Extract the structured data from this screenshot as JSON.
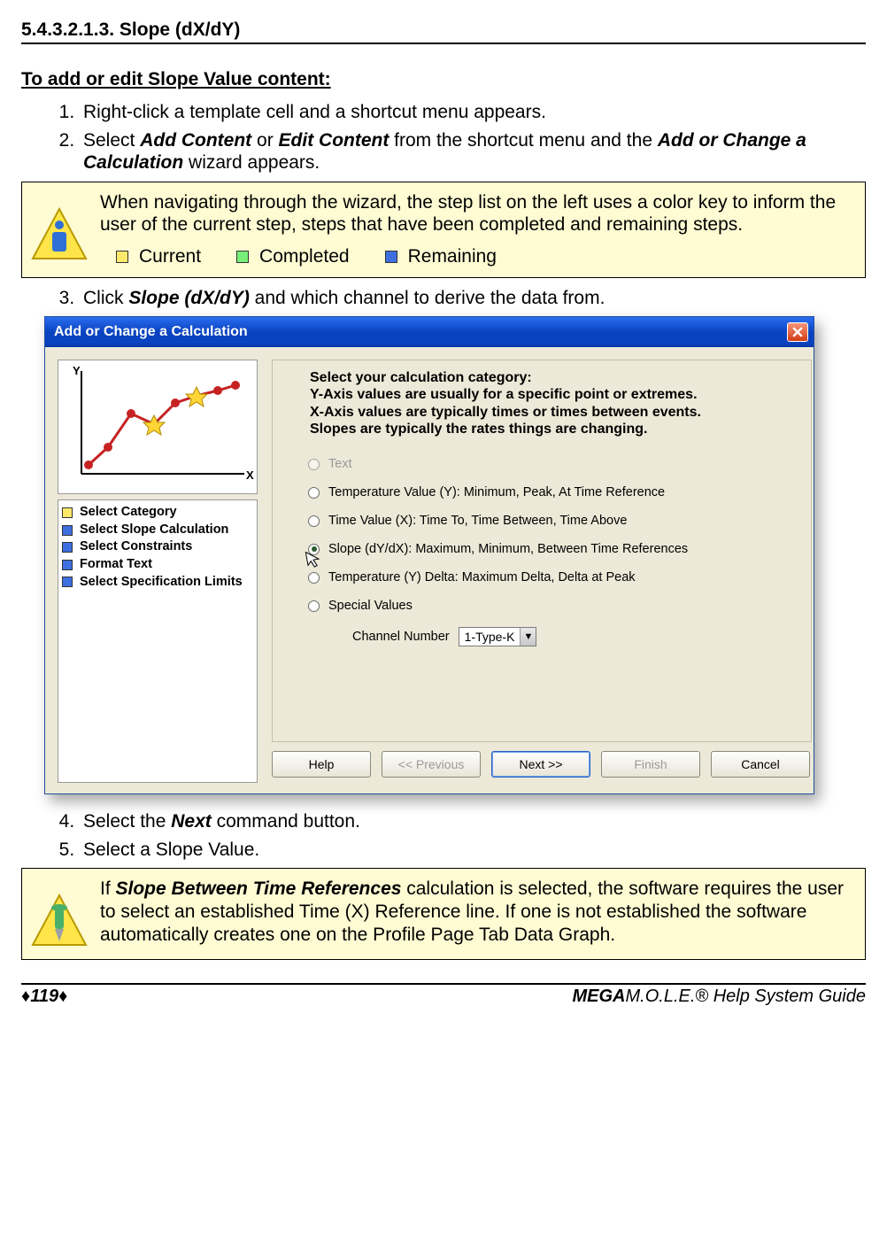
{
  "section_number": "5.4.3.2.1.3. Slope (dX/dY)",
  "sub_heading": "To add or edit Slope Value content:",
  "steps": {
    "s1": "Right-click a template cell and a shortcut menu appears.",
    "s2a": "Select ",
    "s2b": "Add Content",
    "s2c": " or ",
    "s2d": "Edit Content",
    "s2e": " from the shortcut menu and the ",
    "s2f": "Add or Change a Calculation",
    "s2g": " wizard appears.",
    "s3a": "Click ",
    "s3b": "Slope (dX/dY)",
    "s3c": " and which channel to derive the data from.",
    "s4a": "Select the ",
    "s4b": "Next",
    "s4c": " command button.",
    "s5": "Select a Slope Value."
  },
  "note1": {
    "text": "When navigating through the wizard, the step list on the left uses a color key to inform the user of the current step, steps that have been completed and remaining steps.",
    "legend": {
      "current": "Current",
      "completed": "Completed",
      "remaining": "Remaining"
    }
  },
  "note2": {
    "a": "If ",
    "b": "Slope Between Time References",
    "c": " calculation is selected, the software requires the user to select an established Time (X) Reference line. If one is not established the software automatically creates one on the Profile Page Tab Data Graph."
  },
  "dialog": {
    "title": "Add or Change a Calculation",
    "steps": [
      "Select Category",
      "Select Slope Calculation",
      "Select Constraints",
      "Format Text",
      "Select Specification Limits"
    ],
    "group_head": {
      "l1": "Select your calculation category:",
      "l2": "Y-Axis values are usually for a specific point or extremes.",
      "l3": "X-Axis values are typically times or times between events.",
      "l4": "Slopes are typically the rates things are changing."
    },
    "radios": {
      "r0": "Text",
      "r1": "Temperature Value (Y):  Minimum, Peak, At Time Reference",
      "r2": "Time Value (X):  Time To, Time Between, Time Above",
      "r3": "Slope (dY/dX):  Maximum, Minimum, Between Time References",
      "r4": "Temperature (Y) Delta:  Maximum Delta, Delta at Peak",
      "r5": "Special  Values"
    },
    "channel_label": "Channel Number",
    "channel_value": "1-Type-K",
    "buttons": {
      "help": "Help",
      "prev": "<< Previous",
      "next": "Next >>",
      "finish": "Finish",
      "cancel": "Cancel"
    }
  },
  "footer": {
    "page": "♦119♦",
    "guide_prefix": "MEGA",
    "guide_rest": "M.O.L.E.® Help System Guide"
  },
  "chart_data": {
    "type": "line",
    "x": [
      0,
      1,
      2,
      3,
      4,
      5,
      6,
      7
    ],
    "y": [
      0.3,
      0.9,
      2.2,
      1.8,
      2.6,
      3.0,
      3.3,
      3.5
    ],
    "markers": {
      "star_at_x": [
        3,
        5
      ]
    },
    "xlabel": "X",
    "ylabel": "Y",
    "xlim": [
      0,
      8
    ],
    "ylim": [
      0,
      4
    ]
  }
}
